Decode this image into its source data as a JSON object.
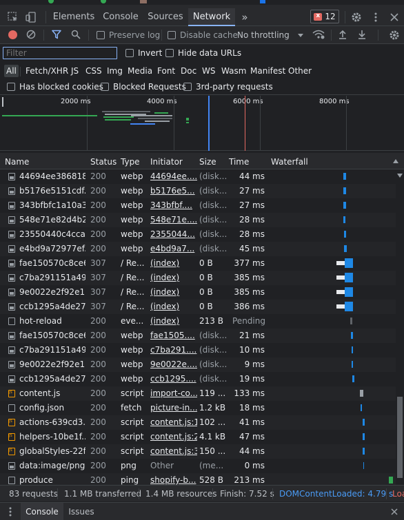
{
  "top_tabs": {
    "elements": "Elements",
    "console": "Console",
    "sources": "Sources",
    "network": "Network",
    "more": "»",
    "error_count": "12"
  },
  "toolbar": {
    "preserve_log": "Preserve log",
    "disable_cache": "Disable cache",
    "throttling": "No throttling"
  },
  "filter": {
    "placeholder": "Filter",
    "invert": "Invert",
    "hide_data_urls": "Hide data URLs"
  },
  "type_filters": [
    "All",
    "Fetch/XHR",
    "JS",
    "CSS",
    "Img",
    "Media",
    "Font",
    "Doc",
    "WS",
    "Wasm",
    "Manifest",
    "Other"
  ],
  "block_filters": {
    "blocked_cookies": "Has blocked cookies",
    "blocked_requests": "Blocked Requests",
    "third_party": "3rd-party requests"
  },
  "overview": {
    "ticks": [
      "2000 ms",
      "4000 ms",
      "6000 ms",
      "8000 ms"
    ]
  },
  "columns": {
    "name": "Name",
    "status": "Status",
    "type": "Type",
    "initiator": "Initiator",
    "size": "Size",
    "time": "Time",
    "waterfall": "Waterfall"
  },
  "rows": [
    {
      "name": "44694ee386818...",
      "status": "200",
      "type": "webp",
      "initiator": "44694ee....",
      "size": "(disk...",
      "time": "44 ms",
      "icon": "img"
    },
    {
      "name": "b5176e5151cdf...",
      "status": "200",
      "type": "webp",
      "initiator": "b5176e5...",
      "size": "(disk...",
      "time": "27 ms",
      "icon": "img"
    },
    {
      "name": "343bfbfc1a10a3...",
      "status": "200",
      "type": "webp",
      "initiator": "343bfbf....",
      "size": "(disk...",
      "time": "27 ms",
      "icon": "img"
    },
    {
      "name": "548e71e82d4b2...",
      "status": "200",
      "type": "webp",
      "initiator": "548e71e....",
      "size": "(disk...",
      "time": "28 ms",
      "icon": "img"
    },
    {
      "name": "23550440c4cca...",
      "status": "200",
      "type": "webp",
      "initiator": "2355044...",
      "size": "(disk...",
      "time": "28 ms",
      "icon": "img"
    },
    {
      "name": "e4bd9a72977ef...",
      "status": "200",
      "type": "webp",
      "initiator": "e4bd9a7...",
      "size": "(disk...",
      "time": "45 ms",
      "icon": "img"
    },
    {
      "name": "fae150570c8ce6...",
      "status": "307",
      "type": "/ Re...",
      "initiator": "(index)",
      "size": "0 B",
      "time": "377 ms",
      "icon": "img"
    },
    {
      "name": "c7ba291151a49...",
      "status": "307",
      "type": "/ Re...",
      "initiator": "(index)",
      "size": "0 B",
      "time": "385 ms",
      "icon": "img"
    },
    {
      "name": "9e0022e2f92e1...",
      "status": "307",
      "type": "/ Re...",
      "initiator": "(index)",
      "size": "0 B",
      "time": "385 ms",
      "icon": "img"
    },
    {
      "name": "ccb1295a4de27...",
      "status": "307",
      "type": "/ Re...",
      "initiator": "(index)",
      "size": "0 B",
      "time": "386 ms",
      "icon": "img"
    },
    {
      "name": "hot-reload",
      "status": "200",
      "type": "eve...",
      "initiator": "(index)",
      "size": "213 B",
      "time": "Pending",
      "icon": "doc"
    },
    {
      "name": "fae150570c8ce6...",
      "status": "200",
      "type": "webp",
      "initiator": "fae1505....",
      "size": "(disk...",
      "time": "21 ms",
      "icon": "img"
    },
    {
      "name": "c7ba291151a49...",
      "status": "200",
      "type": "webp",
      "initiator": "c7ba291....",
      "size": "(disk...",
      "time": "10 ms",
      "icon": "img"
    },
    {
      "name": "9e0022e2f92e1...",
      "status": "200",
      "type": "webp",
      "initiator": "9e0022e....",
      "size": "(disk...",
      "time": "9 ms",
      "icon": "img"
    },
    {
      "name": "ccb1295a4de27...",
      "status": "200",
      "type": "webp",
      "initiator": "ccb1295....",
      "size": "(disk...",
      "time": "19 ms",
      "icon": "img"
    },
    {
      "name": "content.js",
      "status": "200",
      "type": "script",
      "initiator": "import-co...",
      "size": "119 ...",
      "time": "133 ms",
      "icon": "js"
    },
    {
      "name": "config.json",
      "status": "200",
      "type": "fetch",
      "initiator": "picture-in...",
      "size": "1.2 kB",
      "time": "18 ms",
      "icon": "doc"
    },
    {
      "name": "actions-639cd3...",
      "status": "200",
      "type": "script",
      "initiator": "content.js:1",
      "size": "102 ...",
      "time": "41 ms",
      "icon": "js"
    },
    {
      "name": "helpers-10be1f...",
      "status": "200",
      "type": "script",
      "initiator": "content.js:2",
      "size": "4.1 kB",
      "time": "47 ms",
      "icon": "js"
    },
    {
      "name": "globalStyles-22f...",
      "status": "200",
      "type": "script",
      "initiator": "content.js:3",
      "size": "150 ...",
      "time": "44 ms",
      "icon": "js"
    },
    {
      "name": "data:image/png...",
      "status": "200",
      "type": "png",
      "initiator": "Other",
      "size": "(me...",
      "time": "0 ms",
      "icon": "img"
    },
    {
      "name": "produce",
      "status": "200",
      "type": "ping",
      "initiator": "shopify-b...",
      "size": "528 B",
      "time": "213 ms",
      "icon": "doc"
    }
  ],
  "status_bar": {
    "requests": "83 requests",
    "transferred": "1.1 MB transferred",
    "resources": "1.4 MB resources",
    "finish": "Finish: 7.52 s",
    "dcl": "DOMContentLoaded: 4.79 s",
    "load": "Loa"
  },
  "drawer": {
    "console": "Console",
    "issues": "Issues"
  },
  "colors": {
    "accent_blue": "#8ab4f8",
    "bar_blue": "#1a73e8",
    "dcl_blue": "#4285f4",
    "load_red": "#e46962",
    "record_red": "#e46962"
  }
}
